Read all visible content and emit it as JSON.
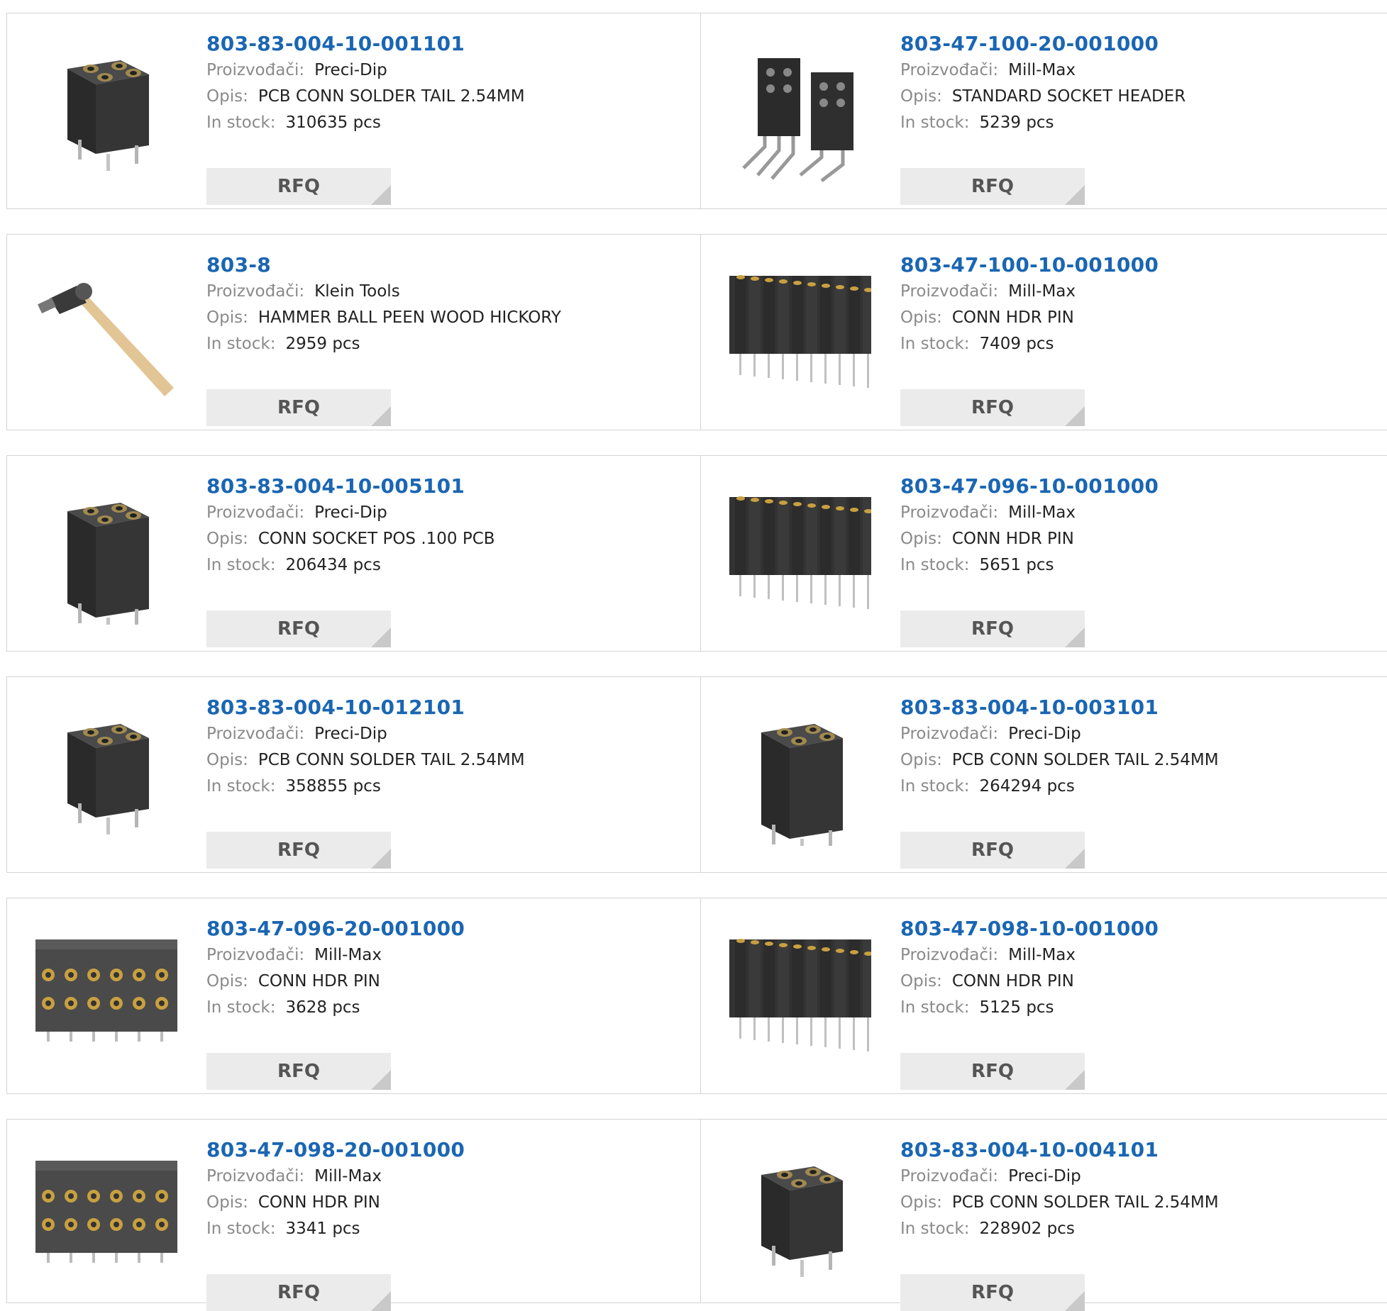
{
  "labels": {
    "manufacturer": "Proizvođači:",
    "description": "Opis:",
    "stock": "In stock:"
  },
  "rfq_label": "RFQ",
  "products": [
    {
      "part": "803-83-004-10-001101",
      "manufacturer": "Preci-Dip",
      "description": "PCB CONN SOLDER TAIL 2.54MM",
      "stock": "310635 pcs",
      "image": "socket-4-pin-icon"
    },
    {
      "part": "803-47-100-20-001000",
      "manufacturer": "Mill-Max",
      "description": "STANDARD SOCKET HEADER",
      "stock": "5239 pcs",
      "image": "socket-header-right-angle-icon"
    },
    {
      "part": "803-8",
      "manufacturer": "Klein Tools",
      "description": "HAMMER BALL PEEN WOOD HICKORY",
      "stock": "2959 pcs",
      "image": "hammer-icon"
    },
    {
      "part": "803-47-100-10-001000",
      "manufacturer": "Mill-Max",
      "description": "CONN HDR PIN",
      "stock": "7409 pcs",
      "image": "header-strip-single-icon"
    },
    {
      "part": "803-83-004-10-005101",
      "manufacturer": "Preci-Dip",
      "description": "CONN SOCKET POS .100 PCB",
      "stock": "206434 pcs",
      "image": "socket-tall-icon"
    },
    {
      "part": "803-47-096-10-001000",
      "manufacturer": "Mill-Max",
      "description": "CONN HDR PIN",
      "stock": "5651 pcs",
      "image": "header-strip-single-icon"
    },
    {
      "part": "803-83-004-10-012101",
      "manufacturer": "Preci-Dip",
      "description": "PCB CONN SOLDER TAIL 2.54MM",
      "stock": "358855 pcs",
      "image": "socket-4-pin-icon"
    },
    {
      "part": "803-83-004-10-003101",
      "manufacturer": "Preci-Dip",
      "description": "PCB CONN SOLDER TAIL 2.54MM",
      "stock": "264294 pcs",
      "image": "socket-tall-icon"
    },
    {
      "part": "803-47-096-20-001000",
      "manufacturer": "Mill-Max",
      "description": "CONN HDR PIN",
      "stock": "3628 pcs",
      "image": "header-strip-double-icon"
    },
    {
      "part": "803-47-098-10-001000",
      "manufacturer": "Mill-Max",
      "description": "CONN HDR PIN",
      "stock": "5125 pcs",
      "image": "header-strip-single-icon"
    },
    {
      "part": "803-47-098-20-001000",
      "manufacturer": "Mill-Max",
      "description": "CONN HDR PIN",
      "stock": "3341 pcs",
      "image": "header-strip-double-icon"
    },
    {
      "part": "803-83-004-10-004101",
      "manufacturer": "Preci-Dip",
      "description": "PCB CONN SOLDER TAIL 2.54MM",
      "stock": "228902 pcs",
      "image": "socket-4-pin-icon"
    }
  ]
}
